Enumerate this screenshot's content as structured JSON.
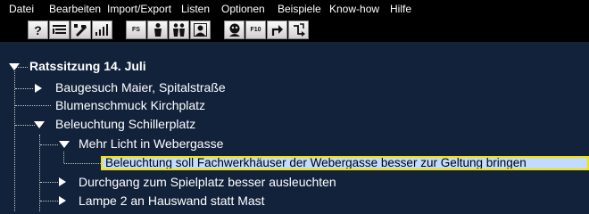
{
  "menu": [
    "Datei",
    "Bearbeiten",
    "Import/Export",
    "Listen",
    "Optionen",
    "Beispiele",
    "Know-how",
    "Hilfe"
  ],
  "toolbar": {
    "help_label": "?",
    "fs_label": "FS",
    "f10_label": "F10"
  },
  "tree": {
    "root": "Ratssitzung 14. Juli",
    "items": [
      "Baugesuch Maier, Spitalstraße",
      "Blumenschmuck Kirchplatz",
      "Beleuchtung Schillerplatz",
      "Mehr Licht in Webergasse",
      "Beleuchtung soll Fachwerkhäuser der Webergasse besser zur Geltung bringen",
      "Durchgang zum Spielplatz besser ausleuchten",
      "Lampe 2 an Hauswand statt Mast"
    ]
  },
  "colors": {
    "background": "#12223b",
    "selection_fill": "#c2dcff",
    "selection_border": "#f2e205"
  }
}
